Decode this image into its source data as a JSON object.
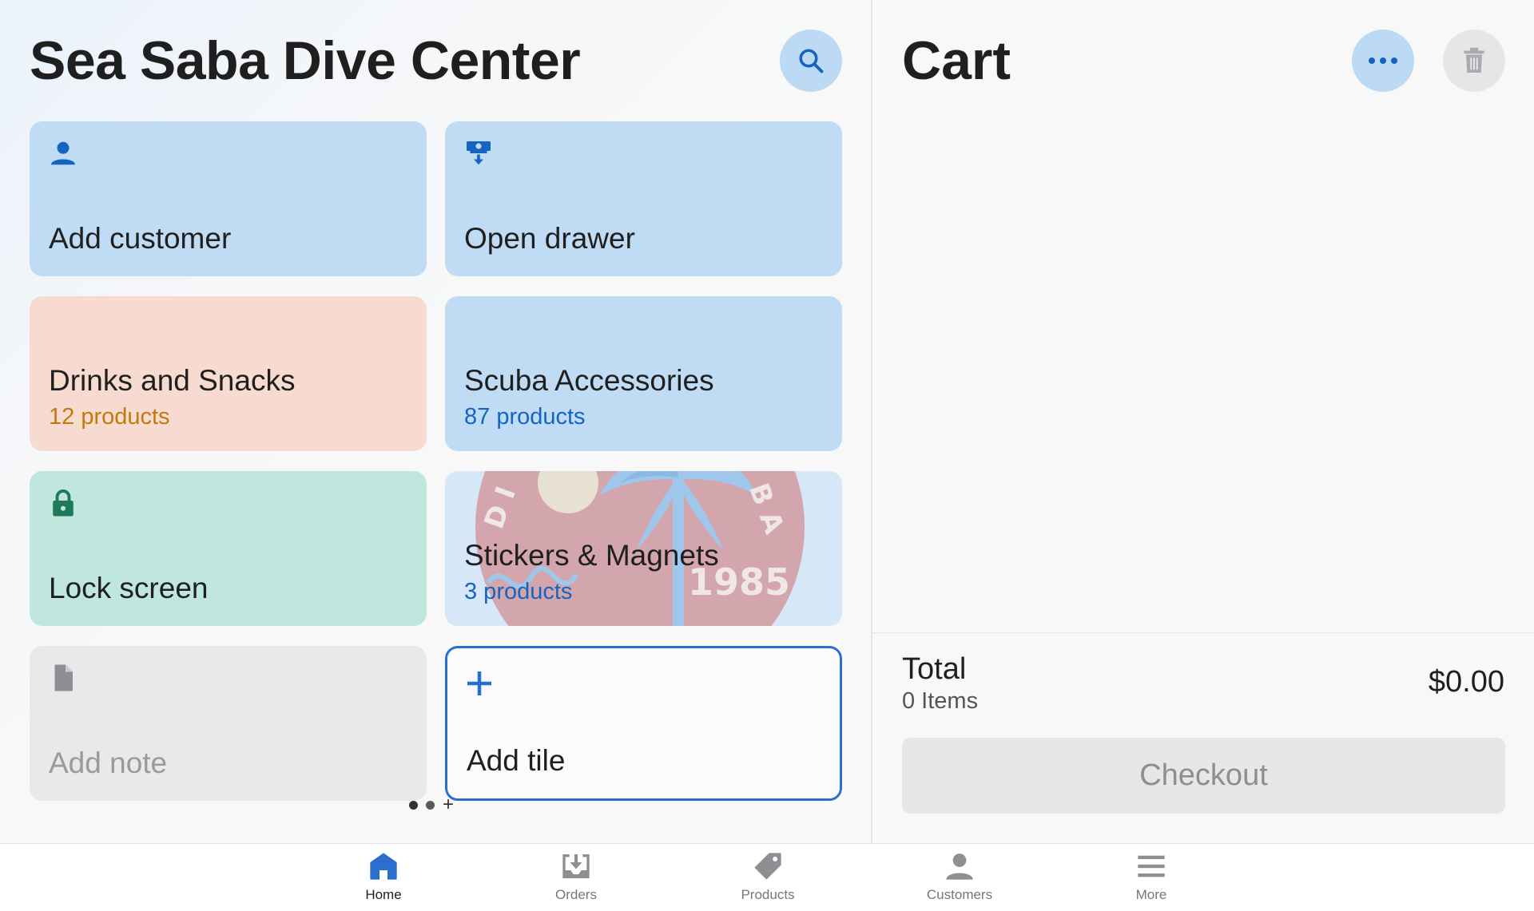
{
  "header": {
    "title": "Sea Saba Dive Center"
  },
  "tiles": {
    "add_customer": {
      "label": "Add customer",
      "icon": "person-icon"
    },
    "open_drawer": {
      "label": "Open drawer",
      "icon": "cash-drawer-icon"
    },
    "drinks": {
      "label": "Drinks and Snacks",
      "sub": "12 products",
      "color": "#f8dbd0"
    },
    "scuba": {
      "label": "Scuba Accessories",
      "sub": "87 products",
      "color": "#c0dcf4"
    },
    "lock": {
      "label": "Lock screen",
      "icon": "lock-icon"
    },
    "stickers": {
      "label": "Stickers & Magnets",
      "sub": "3 products",
      "seal_text": "DIVE SABA",
      "seal_year": "1985"
    },
    "note": {
      "label": "Add note",
      "icon": "document-icon"
    },
    "add_tile": {
      "label": "Add tile",
      "icon": "plus-icon"
    }
  },
  "pager": {
    "pages": 2,
    "current": 1,
    "add": "+"
  },
  "cart": {
    "title": "Cart",
    "total_label": "Total",
    "items": "0 Items",
    "total": "$0.00",
    "checkout": "Checkout"
  },
  "nav": {
    "home": "Home",
    "orders": "Orders",
    "products": "Products",
    "customers": "Customers",
    "more": "More"
  },
  "colors": {
    "accent": "#2c6ed0",
    "tile_blue": "#c0dcf4",
    "tile_peach": "#f8dbd0",
    "tile_green": "#c0e7de",
    "tile_gray": "#e8e9eb"
  }
}
